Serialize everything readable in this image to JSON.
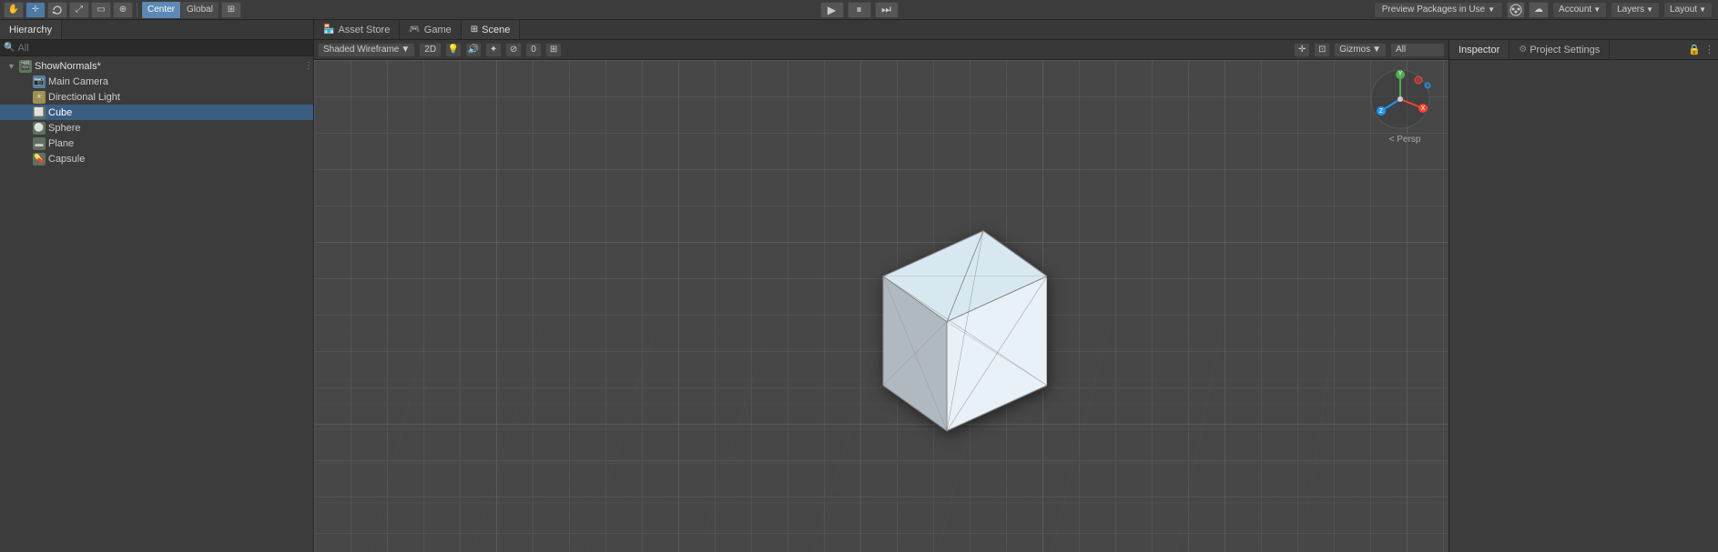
{
  "topToolbar": {
    "tools": [
      {
        "id": "hand",
        "icon": "✋",
        "label": "Hand Tool"
      },
      {
        "id": "move",
        "icon": "✛",
        "label": "Move Tool"
      },
      {
        "id": "rotate",
        "icon": "↻",
        "label": "Rotate Tool"
      },
      {
        "id": "scale",
        "icon": "⤢",
        "label": "Scale Tool"
      },
      {
        "id": "rect",
        "icon": "▭",
        "label": "Rect Tool"
      },
      {
        "id": "transform",
        "icon": "⊕",
        "label": "Transform Tool"
      }
    ],
    "pivotCenter": "Center",
    "pivotSpace": "Global",
    "extraBtn": "⊞",
    "playBtn": "▶",
    "pauseBtn": "⏸",
    "stepBtn": "⏭",
    "previewLabel": "Preview Packages in Use",
    "cloudIcon": "☁",
    "accountLabel": "Account",
    "layersLabel": "Layers",
    "layoutLabel": "Layout"
  },
  "secondToolbar": {
    "tabs": [
      {
        "id": "asset-store",
        "icon": "🏪",
        "label": "Asset Store",
        "active": false
      },
      {
        "id": "game",
        "icon": "🎮",
        "label": "Game",
        "active": false
      },
      {
        "id": "scene",
        "icon": "⊞",
        "label": "Scene",
        "active": true
      }
    ]
  },
  "sceneToolbar": {
    "shading": "Shaded Wireframe",
    "dim": "2D",
    "icons": [
      "💡",
      "🔊",
      "✦",
      "0",
      "⊞"
    ]
  },
  "sceneToolbarRight": {
    "gizmosLabel": "Gizmos",
    "searchPlaceholder": "All"
  },
  "hierarchy": {
    "title": "Hierarchy",
    "searchPlaceholder": "All",
    "items": [
      {
        "id": "show-normals",
        "label": "ShowNormals*",
        "indent": 0,
        "type": "root",
        "expanded": true
      },
      {
        "id": "main-camera",
        "label": "Main Camera",
        "indent": 1,
        "type": "camera"
      },
      {
        "id": "directional-light",
        "label": "Directional Light",
        "indent": 1,
        "type": "light"
      },
      {
        "id": "cube",
        "label": "Cube",
        "indent": 1,
        "type": "cube",
        "selected": true
      },
      {
        "id": "sphere",
        "label": "Sphere",
        "indent": 1,
        "type": "sphere"
      },
      {
        "id": "plane",
        "label": "Plane",
        "indent": 1,
        "type": "plane"
      },
      {
        "id": "capsule",
        "label": "Capsule",
        "indent": 1,
        "type": "capsule"
      }
    ]
  },
  "rightPanel": {
    "inspectorLabel": "Inspector",
    "projectSettingsLabel": "Project Settings"
  },
  "gizmo": {
    "perspLabel": "< Persp"
  }
}
